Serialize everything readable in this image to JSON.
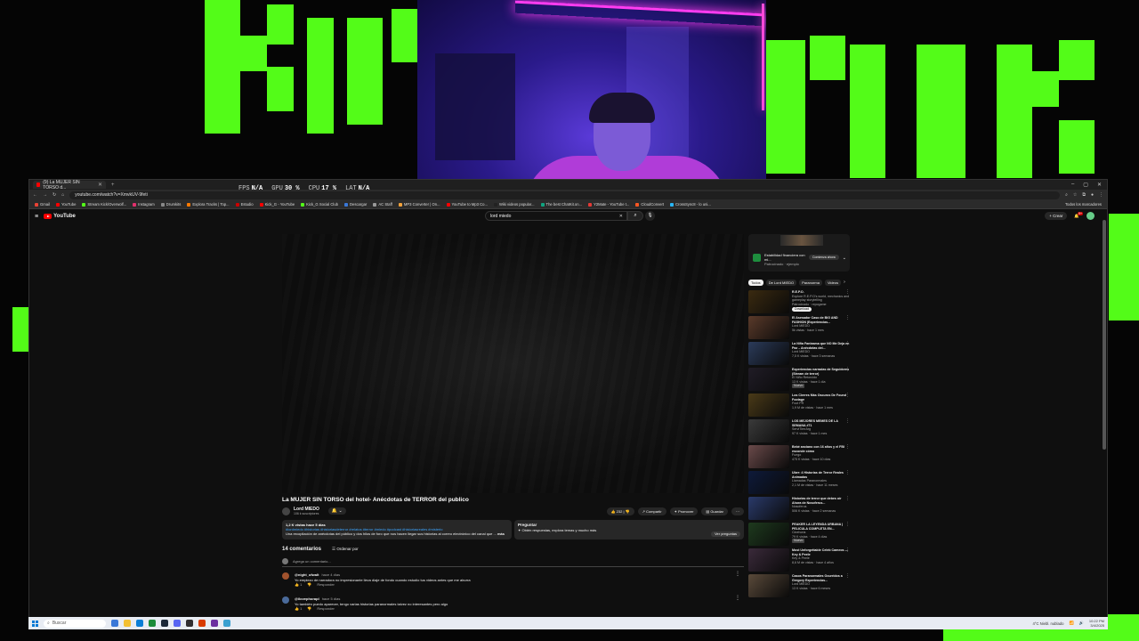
{
  "overlay": {
    "stats": [
      {
        "label": "FPS",
        "value": "N/A"
      },
      {
        "label": "GPU",
        "value": "30 %"
      },
      {
        "label": "CPU",
        "value": "17 %"
      },
      {
        "label": "LAT",
        "value": "N/A"
      }
    ],
    "accent_color": "#53fc18"
  },
  "browser": {
    "tab_title": "(9) La MUJER SIN TORSO d...",
    "url": "youtube.com/watch?v=XmvkUV-9feti",
    "bookmarks": [
      "Gmail",
      "YouTube",
      "Stream Kick/Overwolf...",
      "Instagram",
      "Drumkits",
      "Explora Tracks | Top...",
      "Estudio",
      "Kick_G - YouTube",
      "Kick_G Social Club",
      "Descargar",
      "AC Staff",
      "MP3 Converter | On...",
      "YouTube to Mp3 Co...",
      "Wiki videos popular...",
      "The best ChatKit.on...",
      "Y2Mate - YouTube t...",
      "CloudConvert",
      "CrossSync8 - lo uni..."
    ],
    "all_bookmarks": "Todos los marcadores"
  },
  "youtube": {
    "logo": "YouTube",
    "search_value": "lord miedo",
    "create_label": "Crear",
    "notif_count": "9+"
  },
  "video": {
    "title": "La MUJER SIN TORSO del hotel- Anécdotas de TERROR del publico",
    "channel": "Lord MIEDO",
    "subs": "106 k suscriptores",
    "likes": "232",
    "share": "Compartir",
    "promote": "Promover",
    "save": "Guardar",
    "views_line": "1,2 K vistas  hace 5 días",
    "tags": "#lordmiedo #historias #historiasdeterror #relatos #terror #miedo #podcast #historiasreales #misterio",
    "desc_text": "Una recopilación de anécdotas del público y dos hilos de foro que nos hacen llegar sus historias al correo electrónico del canal que ...",
    "desc_more": "más",
    "ask_title": "Preguntar",
    "ask_text": "Obtén respuestas, explora temas y mucho más",
    "ask_button": "Ver preguntas"
  },
  "comments": {
    "count": "14 comentarios",
    "sort": "Ordenar por",
    "add_placeholder": "Agrega un comentario...",
    "items": [
      {
        "user": "@night_ofwalt",
        "time": "hace 4 días",
        "text": "Yo empiezo de narradora no impresionante lleva diaje de fondo cuando estudio tus videos antes que me aburra",
        "likes": "1",
        "reply": "Responder"
      },
      {
        "user": "@ilovephorapl",
        "time": "hace 5 días",
        "text": "Yo también puedo aparecer, tengo varias historias paranormales talvez no interesantes pero algo",
        "likes": "1",
        "reply": "Responder"
      }
    ]
  },
  "sidebar": {
    "ad": {
      "title": "Estabilidad financiera con mi...",
      "sponsor": "Patrocinado · ejemplo",
      "button": "Comienza ahora"
    },
    "chips": [
      "Todos",
      "De Lord MIEDO",
      "Paranorma",
      "Videos"
    ],
    "recs": [
      {
        "title": "R.E.P.O.",
        "channel": "Explore R.E.P.O's world, mechanics and gameplay storytelling",
        "meta": "Patrocinado · repogame",
        "extra": "Download",
        "color": "#3a2a10"
      },
      {
        "title": "El Asesador Caso de BIG AND FASHION |Experiencias...",
        "channel": "Lord MIEDO",
        "meta": "5k vistas · hace 1 mes",
        "extra": "",
        "color": "#5a3a2a"
      },
      {
        "title": "La Niña Fantasma que NO Me Deja en Paz – Anécdotas del...",
        "channel": "Lord MIEDO",
        "meta": "7,5 K vistas · hace 3 semanas",
        "extra": "",
        "color": "#2b3b5a"
      },
      {
        "title": "Experiencias narradas de Seguidores (Stream de terror)",
        "channel": "El Niño Retorcido",
        "meta": "13 K vistas · hace 1 día",
        "extra": "Nuevo",
        "color": "#201c26"
      },
      {
        "title": "Los Cierres Más Oscuros De Found Footage",
        "channel": "Foot PR",
        "meta": "1,9 M de vistas · hace 1 mes",
        "extra": "",
        "color": "#4a3a18"
      },
      {
        "title": "LOS MEJORES MEMES DE LA SEMANA #71",
        "channel": "ServiTierrArg",
        "meta": "97 K vistas · hace 1 mes",
        "extra": "",
        "color": "#3a3a3a"
      },
      {
        "title": "Bebé anciano con 16 años y el FBI esconde cómo",
        "channel": "Fuego",
        "meta": "475 K vistas · hace 10 días",
        "extra": "",
        "color": "#6a4a4a"
      },
      {
        "title": "Uber: 4 Historias de Terror Reales Animadas",
        "channel": "Llamadas Paranormales",
        "meta": "2,1 M de vistas · hace 11 meses",
        "extra": "",
        "color": "#0e1a3a"
      },
      {
        "title": "Historias de terror que debes oír Ahora de Nosoferus...",
        "channel": "Nosoferus",
        "meta": "506 K vistas · hace 2 semanas",
        "extra": "",
        "color": "#2a3a6a"
      },
      {
        "title": "PEAKER LA LEYENDA URBANA | PELICULA COMPLETA EN...",
        "channel": "Cinehoria",
        "meta": "79 K vistas · hace 4 días",
        "extra": "Nuevo",
        "color": "#1e3a1e"
      },
      {
        "title": "Most Unforgettable Celeb Cameos — Key & Peele",
        "channel": "Key & Peele",
        "meta": "8,6 M de vistas · hace 4 años",
        "extra": "",
        "color": "#3a2a3a"
      },
      {
        "title": "Casos Paranormales Ocurridos a Gregory Experiencias...",
        "channel": "Lord MIEDO",
        "meta": "13 K vistas · hace 6 meses",
        "extra": "",
        "color": "#5a4a3a"
      }
    ]
  },
  "taskbar": {
    "search": "Buscar",
    "weather": "4°C  Niebl. nublado",
    "time": "10:22 PM",
    "date": "3/4/2025"
  }
}
